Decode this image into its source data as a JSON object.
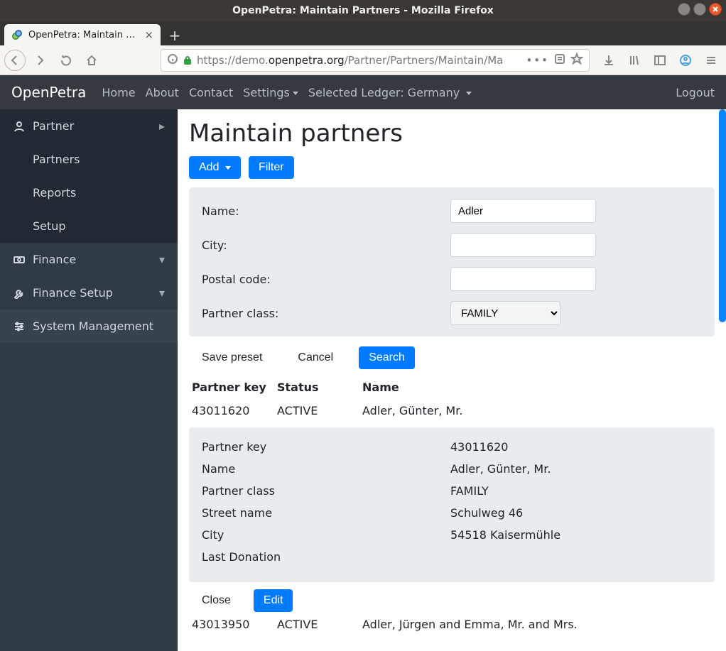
{
  "os_window": {
    "title": "OpenPetra: Maintain Partners - Mozilla Firefox"
  },
  "browser_tab": {
    "title": "OpenPetra: Maintain Par"
  },
  "url": {
    "prefix": "https://demo.",
    "domain": "openpetra.org",
    "suffix": "/Partner/Partners/Maintain/Ma",
    "ellipsis": "•••"
  },
  "navbar": {
    "brand": "OpenPetra",
    "home": "Home",
    "about": "About",
    "contact": "Contact",
    "settings": "Settings",
    "ledger": "Selected Ledger: Germany",
    "logout": "Logout"
  },
  "sidebar": {
    "partner": "Partner",
    "partners": "Partners",
    "reports": "Reports",
    "setup": "Setup",
    "finance": "Finance",
    "finance_setup": "Finance Setup",
    "sysmgmt": "System Management"
  },
  "page": {
    "title": "Maintain partners",
    "add": "Add",
    "filter": "Filter"
  },
  "filter": {
    "name_label": "Name:",
    "name_value": "Adler",
    "city_label": "City:",
    "city_value": "",
    "postal_label": "Postal code:",
    "postal_value": "",
    "class_label": "Partner class:",
    "class_value": "FAMILY",
    "save_preset": "Save preset",
    "cancel": "Cancel",
    "search": "Search"
  },
  "table": {
    "col_key": "Partner key",
    "col_status": "Status",
    "col_name": "Name",
    "rows": [
      {
        "key": "43011620",
        "status": "ACTIVE",
        "name": "Adler, Günter, Mr."
      },
      {
        "key": "43013950",
        "status": "ACTIVE",
        "name": "Adler, Jürgen and Emma, Mr. and Mrs."
      }
    ]
  },
  "detail": {
    "labels": {
      "key": "Partner key",
      "name": "Name",
      "class": "Partner class",
      "street": "Street name",
      "city": "City",
      "last_donation": "Last Donation"
    },
    "values": {
      "key": "43011620",
      "name": "Adler, Günter, Mr.",
      "class": "FAMILY",
      "street": "Schulweg 46",
      "city": "54518 Kaisermühle",
      "last_donation": ""
    },
    "close": "Close",
    "edit": "Edit"
  }
}
